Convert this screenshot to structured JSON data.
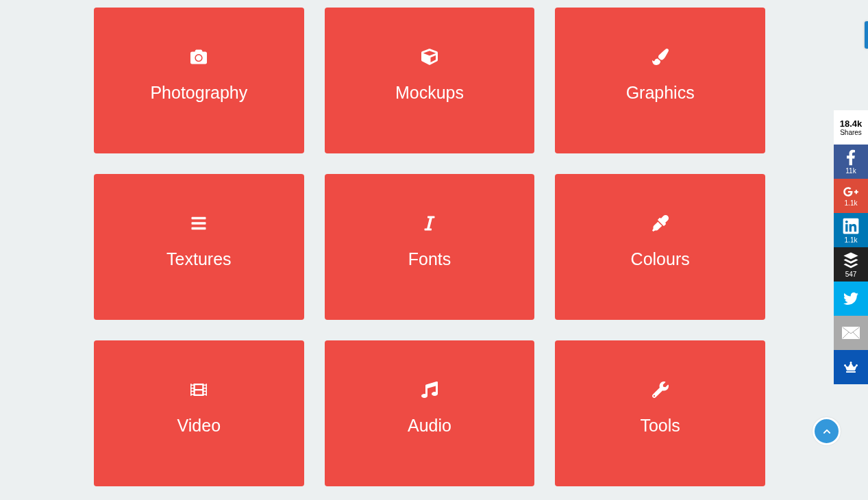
{
  "categories": [
    {
      "title": "Photography"
    },
    {
      "title": "Mockups"
    },
    {
      "title": "Graphics"
    },
    {
      "title": "Textures"
    },
    {
      "title": "Fonts"
    },
    {
      "title": "Colours"
    },
    {
      "title": "Video"
    },
    {
      "title": "Audio"
    },
    {
      "title": "Tools"
    }
  ],
  "share_bar": {
    "total": "18.4k",
    "label": "Shares",
    "buttons": [
      {
        "color": "#3b5998",
        "count": "11k"
      },
      {
        "color": "#dd4b39",
        "count": "1.1k"
      },
      {
        "color": "#0077b5",
        "count": "1.1k"
      },
      {
        "color": "#222222",
        "count": "547"
      },
      {
        "color": "#00aced"
      },
      {
        "color": "#aaaaaa"
      },
      {
        "color": "#0a56b5"
      }
    ]
  }
}
